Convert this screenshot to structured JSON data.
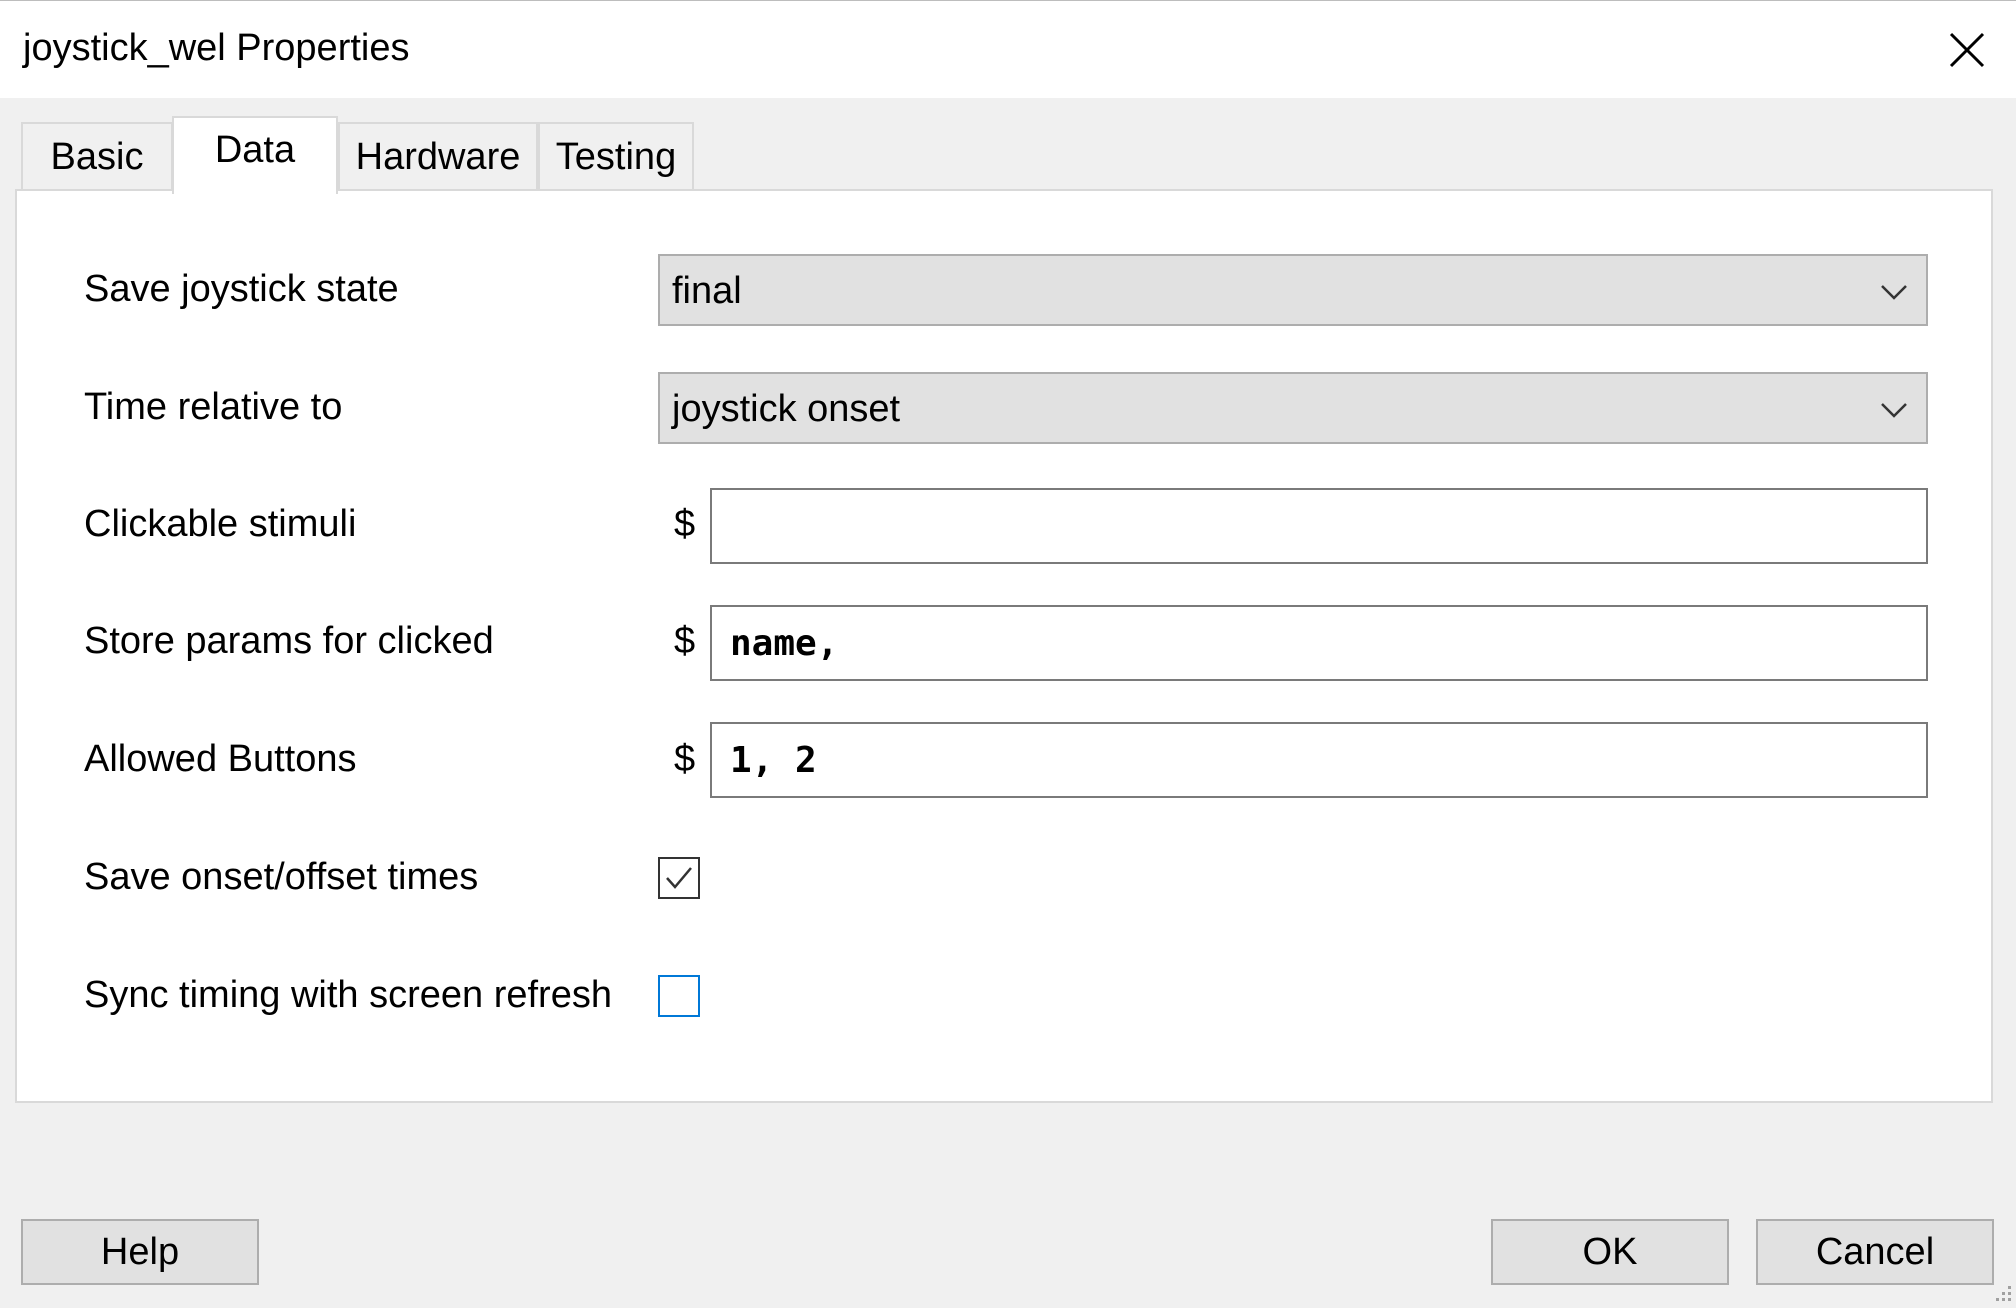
{
  "window": {
    "title": "joystick_wel Properties"
  },
  "tabs": [
    {
      "label": "Basic",
      "active": false
    },
    {
      "label": "Data",
      "active": true
    },
    {
      "label": "Hardware",
      "active": false
    },
    {
      "label": "Testing",
      "active": false
    }
  ],
  "form": {
    "save_state": {
      "label": "Save joystick state",
      "value": "final"
    },
    "time_relative": {
      "label": "Time relative to",
      "value": "joystick onset"
    },
    "clickable_stimuli": {
      "label": "Clickable stimuli",
      "prefix": "$",
      "value": ""
    },
    "store_params": {
      "label": "Store params for clicked",
      "prefix": "$",
      "value": "name,"
    },
    "allowed_buttons": {
      "label": "Allowed Buttons",
      "prefix": "$",
      "value": "1, 2"
    },
    "save_onset": {
      "label": "Save onset/offset times",
      "checked": true
    },
    "sync_timing": {
      "label": "Sync timing with screen refresh",
      "checked": false
    }
  },
  "buttons": {
    "help": "Help",
    "ok": "OK",
    "cancel": "Cancel"
  },
  "colors": {
    "focus_blue": "#0078d7",
    "button_face": "#e1e1e1",
    "dialog_bg": "#f0f0f0"
  }
}
